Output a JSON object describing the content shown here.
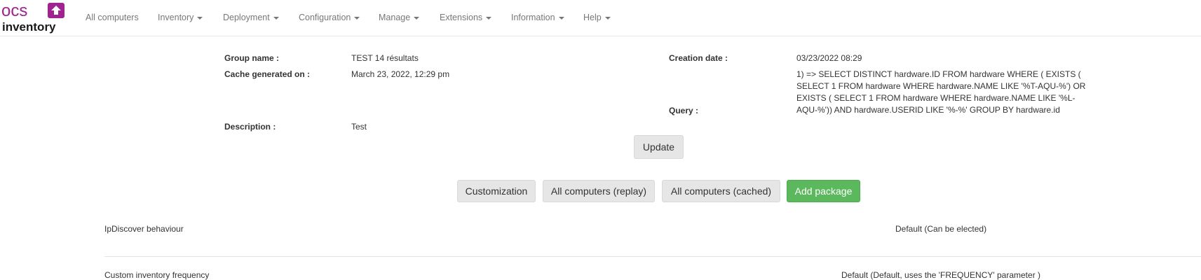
{
  "brand": {
    "logo_text_top": "ocs",
    "logo_text_bottom": "inventory",
    "accent": "#a0248f"
  },
  "nav": {
    "items": [
      {
        "label": "All computers",
        "dropdown": false
      },
      {
        "label": "Inventory",
        "dropdown": true
      },
      {
        "label": "Deployment",
        "dropdown": true
      },
      {
        "label": "Configuration",
        "dropdown": true
      },
      {
        "label": "Manage",
        "dropdown": true
      },
      {
        "label": "Extensions",
        "dropdown": true
      },
      {
        "label": "Information",
        "dropdown": true
      },
      {
        "label": "Help",
        "dropdown": true
      }
    ]
  },
  "group": {
    "name_label": "Group name :",
    "name_value": "TEST 14 résultats",
    "cache_label": "Cache generated on :",
    "cache_value": "March 23, 2022, 12:29 pm",
    "description_label": "Description :",
    "description_value": "Test",
    "creation_label": "Creation date :",
    "creation_value": "03/23/2022 08:29",
    "query_label": "Query :",
    "query_value": "1) => SELECT DISTINCT hardware.ID FROM hardware WHERE ( EXISTS ( SELECT 1 FROM hardware WHERE hardware.NAME LIKE '%T-AQU-%') OR EXISTS ( SELECT 1 FROM hardware WHERE hardware.NAME LIKE '%L-AQU-%')) AND hardware.USERID LIKE '%-%' GROUP BY hardware.id"
  },
  "buttons": {
    "update": "Update",
    "customization": "Customization",
    "replay": "All computers (replay)",
    "cached": "All computers (cached)",
    "add_package": "Add package",
    "success_color": "#5cb85c"
  },
  "settings": [
    {
      "label": "IpDiscover behaviour",
      "value": "Default (Can be elected)"
    },
    {
      "label": "Custom inventory frequency",
      "value": "Default (Default, uses the 'FREQUENCY' parameter )"
    }
  ]
}
